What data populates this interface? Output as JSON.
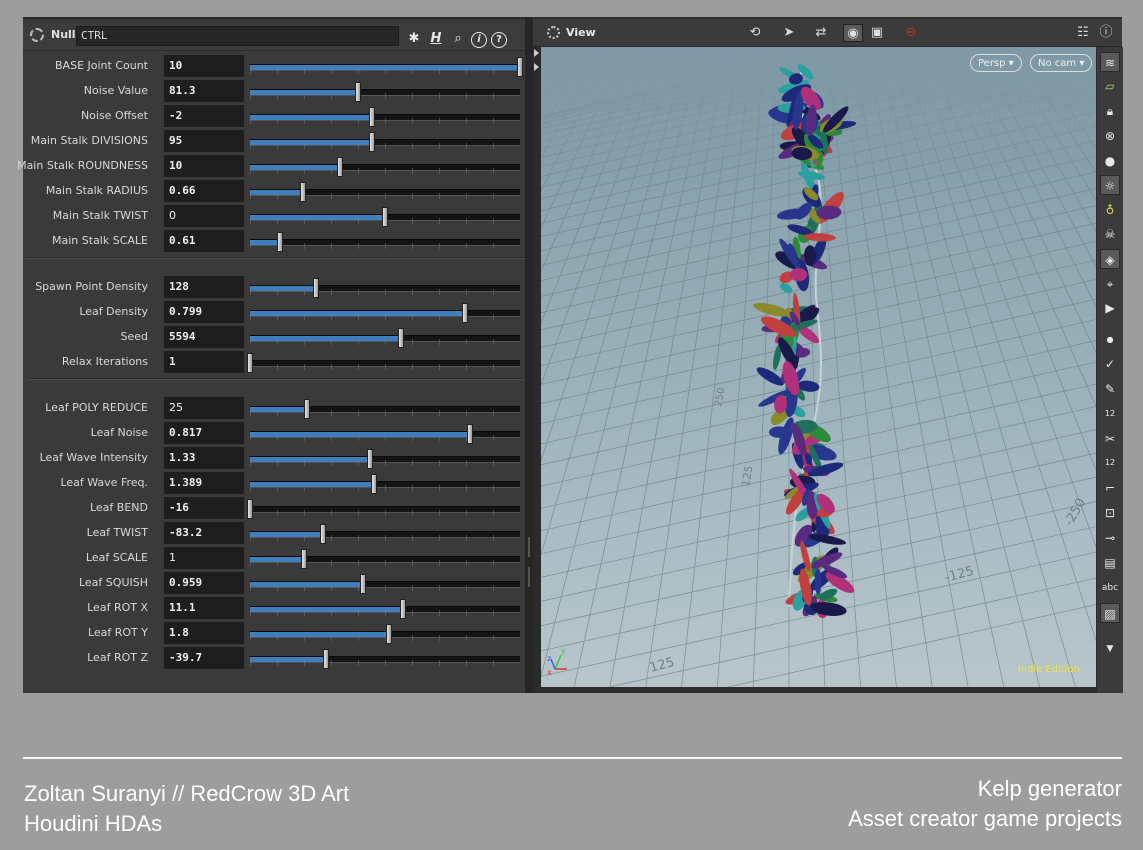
{
  "params": {
    "node_type": "Null",
    "node_name": "CTRL",
    "header_icons": [
      "gear-icon",
      "houdini-h-icon",
      "search-icon",
      "info-icon",
      "help-icon"
    ],
    "groups": [
      [
        {
          "label": "BASE Joint Count",
          "value": "10",
          "slider": 1.0
        },
        {
          "label": "Noise Value",
          "value": "81.3",
          "slider": 0.4
        },
        {
          "label": "Noise Offset",
          "value": "-2",
          "slider": 0.45
        },
        {
          "label": "Main Stalk DIVISIONS",
          "value": "95",
          "slider": 0.45
        },
        {
          "label": "Main Stalk ROUNDNESS",
          "value": "10",
          "slider": 0.335
        },
        {
          "label": "Main Stalk RADIUS",
          "value": "0.66",
          "slider": 0.195
        },
        {
          "label": "Main Stalk TWIST",
          "value": "0",
          "slider": 0.5
        },
        {
          "label": "Main Stalk SCALE",
          "value": "0.61",
          "slider": 0.11
        }
      ],
      [
        {
          "label": "Spawn Point Density",
          "value": "128",
          "slider": 0.245
        },
        {
          "label": "Leaf Density",
          "value": "0.799",
          "slider": 0.795
        },
        {
          "label": "Seed",
          "value": "5594",
          "slider": 0.56
        },
        {
          "label": "Relax Iterations",
          "value": "1",
          "slider": 0.0
        }
      ],
      [
        {
          "label": "Leaf POLY REDUCE",
          "value": "25",
          "slider": 0.21
        },
        {
          "label": "Leaf Noise",
          "value": "0.817",
          "slider": 0.815
        },
        {
          "label": "Leaf Wave Intensity",
          "value": "1.33",
          "slider": 0.445
        },
        {
          "label": "Leaf Wave Freq.",
          "value": "1.389",
          "slider": 0.46
        },
        {
          "label": "Leaf BEND",
          "value": "-16",
          "slider": 0.0
        },
        {
          "label": "Leaf TWIST",
          "value": "-83.2",
          "slider": 0.27
        },
        {
          "label": "Leaf SCALE",
          "value": "1",
          "slider": 0.2
        },
        {
          "label": "Leaf SQUISH",
          "value": "0.959",
          "slider": 0.42
        },
        {
          "label": "Leaf ROT X",
          "value": "11.1",
          "slider": 0.565
        },
        {
          "label": "Leaf ROT Y",
          "value": "1.8",
          "slider": 0.515
        },
        {
          "label": "Leaf ROT Z",
          "value": "-39.7",
          "slider": 0.28
        }
      ]
    ]
  },
  "viewport": {
    "title": "View",
    "camera_menu": "Persp ▾",
    "cam_menu": "No cam ▾",
    "watermark": "Indie Edition",
    "grid_labels": [
      "125",
      "125",
      "-125",
      "125",
      "250",
      "-250"
    ],
    "axis_gizmo": [
      "x",
      "y",
      "z"
    ],
    "sidebar_icons": [
      "display-options-icon",
      "ghost-icon",
      "lock-icon",
      "snap-icon",
      "shading-icon",
      "light-icon",
      "headlight-icon",
      "skeleton-icon",
      "render-icon",
      "camera-icon",
      "video-camera-icon",
      "point-icon",
      "brush-icon",
      "pen-icon",
      "number-icon",
      "scissors-icon",
      "number-icon",
      "corner-icon",
      "transform-icon",
      "pivot-icon",
      "layers-icon",
      "text-label-icon",
      "background-icon"
    ],
    "sidebar_text": {
      "num1": "12",
      "num2": "12",
      "abc": "abc"
    }
  },
  "caption": {
    "left_line1": "Zoltan Suranyi // RedCrow 3D Art",
    "left_line2": "Houdini HDAs",
    "right_line1": "Kelp generator",
    "right_line2": "Asset creator game projects"
  },
  "colors": {
    "background": "#9d9d9d",
    "panel": "#3a3a3a",
    "slider_fill": "#3f7fc0",
    "watermark": "#e8e44a"
  }
}
